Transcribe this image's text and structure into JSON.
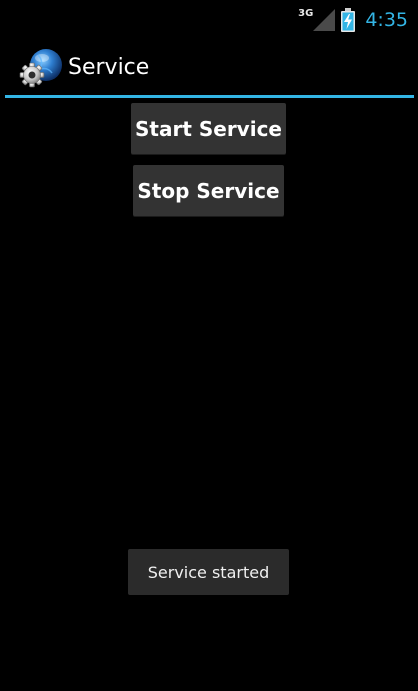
{
  "status_bar": {
    "network_type": "3G",
    "time": "4:35",
    "signal_icon": "signal-icon",
    "battery_icon": "battery-charging-icon"
  },
  "action_bar": {
    "title": "Service",
    "app_icon": "service-gear-globe-icon",
    "accent_color": "#33b5e5"
  },
  "buttons": {
    "start_label": "Start Service",
    "stop_label": "Stop Service"
  },
  "toast": {
    "message": "Service started"
  }
}
